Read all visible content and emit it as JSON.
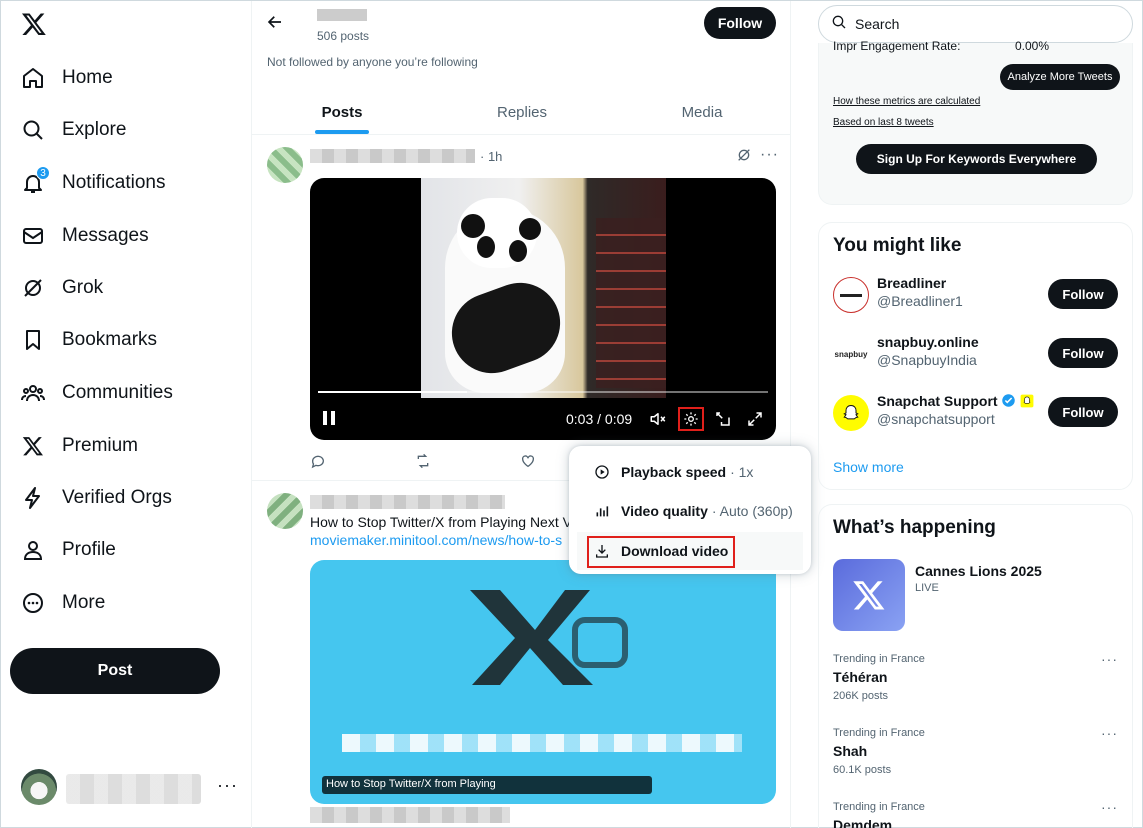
{
  "nav": {
    "items": [
      {
        "label": "Home",
        "icon": "home-icon"
      },
      {
        "label": "Explore",
        "icon": "search-icon"
      },
      {
        "label": "Notifications",
        "icon": "bell-icon",
        "badge": "3"
      },
      {
        "label": "Messages",
        "icon": "envelope-icon"
      },
      {
        "label": "Grok",
        "icon": "grok-icon"
      },
      {
        "label": "Bookmarks",
        "icon": "bookmark-icon"
      },
      {
        "label": "Communities",
        "icon": "people-icon"
      },
      {
        "label": "Premium",
        "icon": "x-logo-icon"
      },
      {
        "label": "Verified Orgs",
        "icon": "lightning-icon"
      },
      {
        "label": "Profile",
        "icon": "person-icon"
      },
      {
        "label": "More",
        "icon": "more-circle-icon"
      }
    ],
    "post_button": "Post"
  },
  "profile": {
    "post_count": "506 posts",
    "follow_label": "Follow",
    "not_followed": "Not followed by anyone you’re following"
  },
  "tabs": [
    {
      "label": "Posts",
      "active": true
    },
    {
      "label": "Replies",
      "active": false
    },
    {
      "label": "Media",
      "active": false
    }
  ],
  "tweet1": {
    "time": "· 1h",
    "video": {
      "time": "0:03 / 0:09",
      "progress": 0.33
    }
  },
  "tweet2": {
    "text": "How to Stop Twitter/X from Playing Next V",
    "link": "moviemaker.minitool.com/news/how-to-s",
    "card_caption": "How to Stop Twitter/X from Playing"
  },
  "video_menu": {
    "playback_speed": {
      "label": "Playback speed",
      "value": "· 1x"
    },
    "video_quality": {
      "label": "Video quality",
      "value": "· Auto (360p)"
    },
    "download": {
      "label": "Download video"
    }
  },
  "search": {
    "placeholder": "Search"
  },
  "keywords_box": {
    "metric_label": "Impr Engagement Rate:",
    "metric_value": "0.00%",
    "analyze_label": "Analyze More Tweets",
    "link1": "How these metrics are calculated",
    "link2": "Based on last 8 tweets",
    "signup_label": "Sign Up For Keywords Everywhere"
  },
  "who_to_follow": {
    "title": "You might like",
    "accounts": [
      {
        "name": "Breadliner",
        "handle": "@Breadliner1",
        "follow": "Follow"
      },
      {
        "name": "snapbuy.online",
        "handle": "@SnapbuyIndia",
        "follow": "Follow",
        "avatar_text": "snapbuy"
      },
      {
        "name": "Snapchat Support",
        "handle": "@snapchatsupport",
        "follow": "Follow",
        "verified": true
      }
    ],
    "show_more": "Show more"
  },
  "happening": {
    "title": "What’s happening",
    "event": {
      "title": "Cannes Lions 2025",
      "status": "LIVE"
    },
    "trends": [
      {
        "context": "Trending in France",
        "name": "Téhéran",
        "count": "206K posts"
      },
      {
        "context": "Trending in France",
        "name": "Shah",
        "count": "60.1K posts"
      },
      {
        "context": "Trending in France",
        "name": "Demdem",
        "count": ""
      }
    ]
  },
  "colors": {
    "accent": "#1d9bf0",
    "dark": "#0f1419",
    "highlight": "#e0201b",
    "muted": "#536471"
  }
}
